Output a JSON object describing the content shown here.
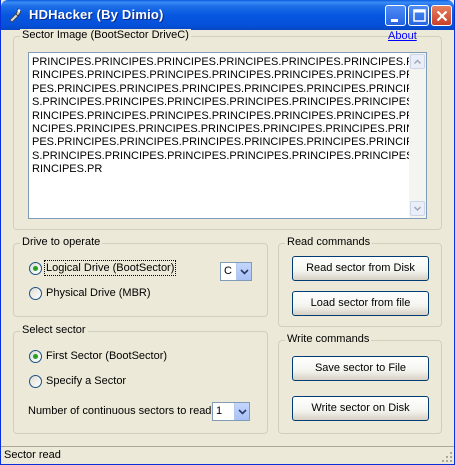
{
  "window": {
    "title": "HDHacker (By Dimio)",
    "icon": "tool-icon"
  },
  "sector_image": {
    "group_label": "Sector Image (BootSector DriveC)",
    "about_link": "About",
    "content": "PRINCIPES.PRINCIPES.PRINCIPES.PRINCIPES.PRINCIPES.PRINCIPES.P\nRINCIPES.PRINCIPES.PRINCIPES.PRINCIPES.PRINCIPES.PRINCIPES.PRINCI\nPES.PRINCIPES.PRINCIPES.PRINCIPES.PRINCIPES.PRINCIPES.PRINCIPE\nS.PRINCIPES.PRINCIPES.PRINCIPES.PRINCIPES.PRINCIPES.PRINCIPES.P\nRINCIPES.PRINCIPES.PRINCIPES.PRINCIPES.PRINCIPES.PRINCIPES.PRI\nNCIPES.PRINCIPES.PRINCIPES.PRINCIPES.PRINCIPES.PRINCIPES.PRINCI\nPES.PRINCIPES.PRINCIPES.PRINCIPES.PRINCIPES.PRINCIPES.PRINCIPE\nS.PRINCIPES.PRINCIPES.PRINCIPES.PRINCIPES.PRINCIPES.PRINCIPES.P\nRINCIPES.PR"
  },
  "drive": {
    "group_label": "Drive to operate",
    "logical_label": "Logical Drive (BootSector)",
    "physical_label": "Physical Drive (MBR)",
    "selected": "logical",
    "drive_letter": "C"
  },
  "read_commands": {
    "group_label": "Read commands",
    "read_disk": "Read sector from Disk",
    "load_file": "Load sector from file"
  },
  "select_sector": {
    "group_label": "Select sector",
    "first_sector_label": "First Sector (BootSector)",
    "specify_label": "Specify a Sector",
    "selected": "first",
    "continuous_label": "Number of continuous sectors to read",
    "continuous_value": "1"
  },
  "write_commands": {
    "group_label": "Write commands",
    "save_file": "Save sector to File",
    "write_disk": "Write sector on Disk"
  },
  "status": {
    "text": "Sector read"
  },
  "colors": {
    "titlebar": "#0757e1",
    "face": "#ece9d8",
    "link": "#0000ff"
  }
}
